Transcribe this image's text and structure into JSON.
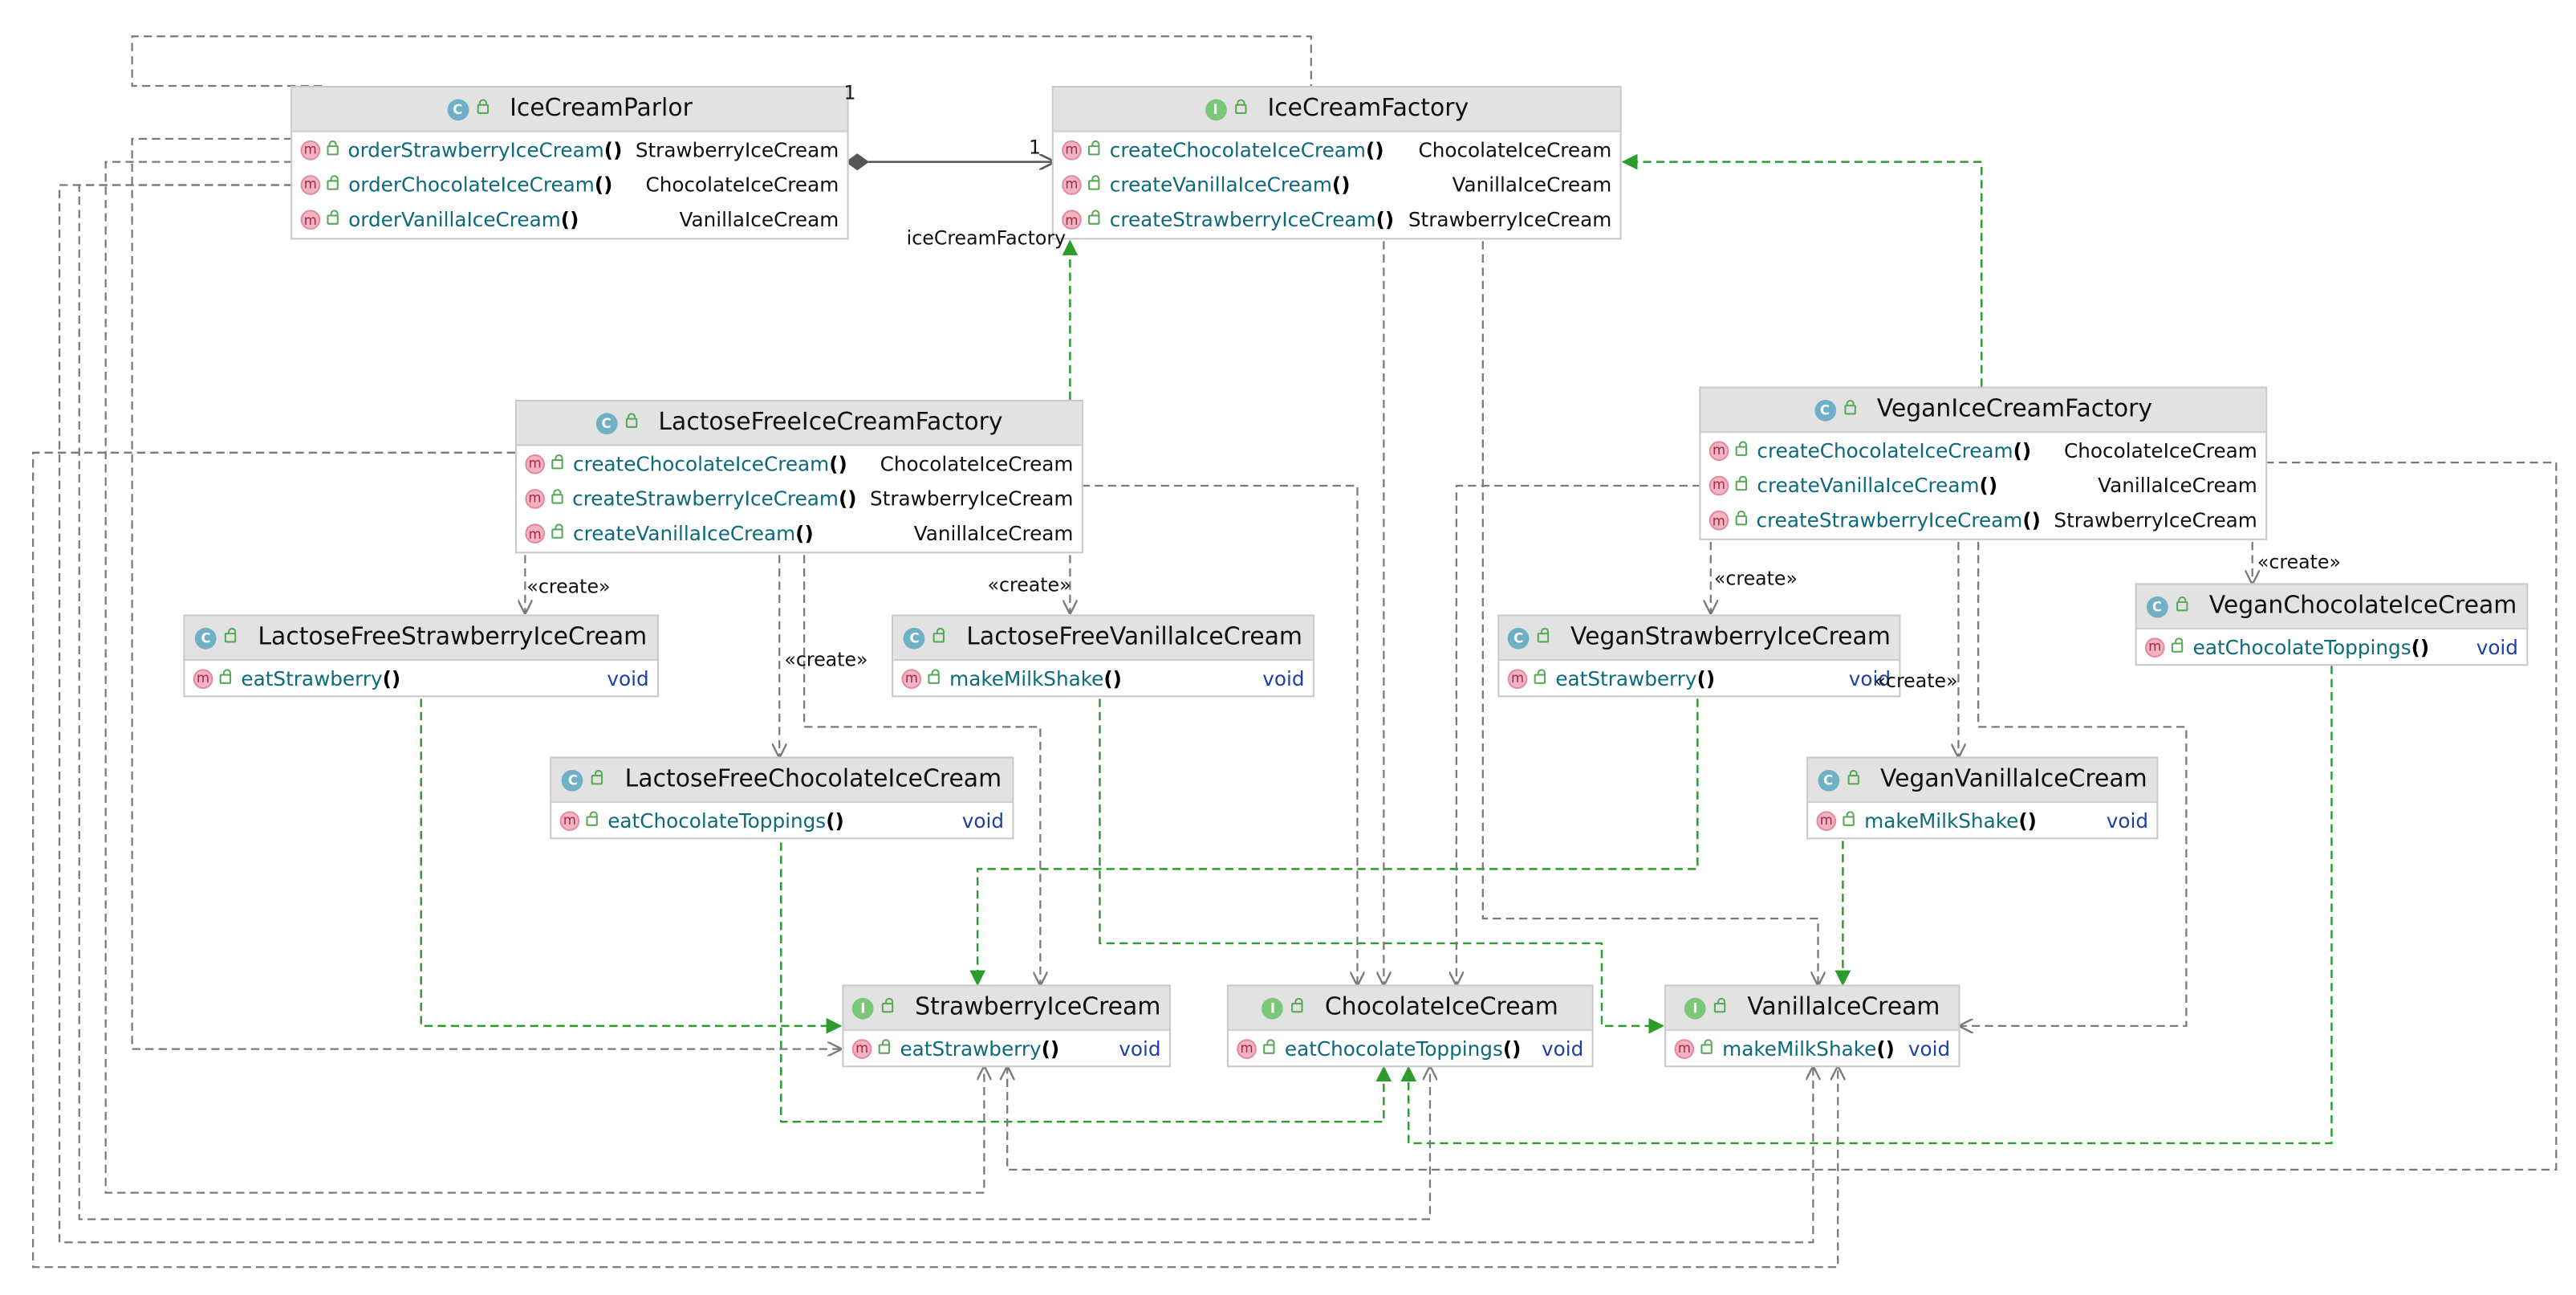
{
  "classes": {
    "icecreamparlor": {
      "kind": "C",
      "name": "IceCreamParlor",
      "methods": [
        {
          "name": "orderStrawberryIceCream",
          "ret": "StrawberryIceCream"
        },
        {
          "name": "orderChocolateIceCream",
          "ret": "ChocolateIceCream"
        },
        {
          "name": "orderVanillaIceCream",
          "ret": "VanillaIceCream"
        }
      ]
    },
    "icecreamfactory": {
      "kind": "I",
      "name": "IceCreamFactory",
      "methods": [
        {
          "name": "createChocolateIceCream",
          "ret": "ChocolateIceCream"
        },
        {
          "name": "createVanillaIceCream",
          "ret": "VanillaIceCream"
        },
        {
          "name": "createStrawberryIceCream",
          "ret": "StrawberryIceCream"
        }
      ]
    },
    "lactosefreeicecreamfactory": {
      "kind": "C",
      "name": "LactoseFreeIceCreamFactory",
      "methods": [
        {
          "name": "createChocolateIceCream",
          "ret": "ChocolateIceCream"
        },
        {
          "name": "createStrawberryIceCream",
          "ret": "StrawberryIceCream"
        },
        {
          "name": "createVanillaIceCream",
          "ret": "VanillaIceCream"
        }
      ]
    },
    "veganicecreamfactory": {
      "kind": "C",
      "name": "VeganIceCreamFactory",
      "methods": [
        {
          "name": "createChocolateIceCream",
          "ret": "ChocolateIceCream"
        },
        {
          "name": "createVanillaIceCream",
          "ret": "VanillaIceCream"
        },
        {
          "name": "createStrawberryIceCream",
          "ret": "StrawberryIceCream"
        }
      ]
    },
    "lactosefreestrawberryicecream": {
      "kind": "C",
      "name": "LactoseFreeStrawberryIceCream",
      "methods": [
        {
          "name": "eatStrawberry",
          "ret": "void"
        }
      ]
    },
    "lactosefreevanillaicecream": {
      "kind": "C",
      "name": "LactoseFreeVanillaIceCream",
      "methods": [
        {
          "name": "makeMilkShake",
          "ret": "void"
        }
      ]
    },
    "veganstrawberryicecream": {
      "kind": "C",
      "name": "VeganStrawberryIceCream",
      "methods": [
        {
          "name": "eatStrawberry",
          "ret": "void"
        }
      ]
    },
    "veganchocolateicecream": {
      "kind": "C",
      "name": "VeganChocolateIceCream",
      "methods": [
        {
          "name": "eatChocolateToppings",
          "ret": "void"
        }
      ]
    },
    "lactosefreechocolateicecream": {
      "kind": "C",
      "name": "LactoseFreeChocolateIceCream",
      "methods": [
        {
          "name": "eatChocolateToppings",
          "ret": "void"
        }
      ]
    },
    "veganvanillaicecream": {
      "kind": "C",
      "name": "VeganVanillaIceCream",
      "methods": [
        {
          "name": "makeMilkShake",
          "ret": "void"
        }
      ]
    },
    "strawberryicecream": {
      "kind": "I",
      "name": "StrawberryIceCream",
      "methods": [
        {
          "name": "eatStrawberry",
          "ret": "void"
        }
      ]
    },
    "chocolateicecream": {
      "kind": "I",
      "name": "ChocolateIceCream",
      "methods": [
        {
          "name": "eatChocolateToppings",
          "ret": "void"
        }
      ]
    },
    "vanillaicecream": {
      "kind": "I",
      "name": "VanillaIceCream",
      "methods": [
        {
          "name": "makeMilkShake",
          "ret": "void"
        }
      ]
    }
  },
  "labels": {
    "multiplicity_parlor": "1",
    "multiplicity_factory": "1",
    "role_factory": "iceCreamFactory",
    "create_lf_strawberry": "«create»",
    "create_lf_vanilla": "«create»",
    "create_lf_chocolate": "«create»",
    "create_vegan_strawberry": "«create»",
    "create_vegan_vanilla": "«create»",
    "create_vegan_chocolate": "«create»"
  },
  "colors": {
    "dependency": "#7a7a7a",
    "realization": "#2e9b2e",
    "association": "#555555",
    "class_badge": "#6fb0c7",
    "interface_badge": "#7bc77a",
    "method_name": "#0d6a7b",
    "void_type": "#1f3fa8"
  }
}
